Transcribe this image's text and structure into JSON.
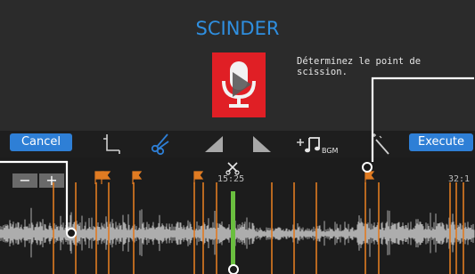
{
  "header": {
    "title": "SCINDER"
  },
  "preview": {
    "thumbnail_icon": "microphone-play-icon",
    "hint": "Déterminez le point de\nscission."
  },
  "toolbar": {
    "cancel_label": "Cancel",
    "execute_label": "Execute",
    "tools": [
      "crop-icon",
      "scissors-icon",
      "fade-in-icon",
      "fade-out-icon",
      "add-bgm-icon",
      "magic-wand-icon"
    ],
    "bgm_label": "BGM"
  },
  "timeline": {
    "zoom_out": "−",
    "zoom_in": "+",
    "cursor_time": "15:25",
    "end_time": "32:1"
  },
  "colors": {
    "accent": "#2e7fd6",
    "title": "#2f8fe0",
    "marker": "#e07b22",
    "playhead": "#6abf3f",
    "thumbnail": "#e01f25"
  }
}
